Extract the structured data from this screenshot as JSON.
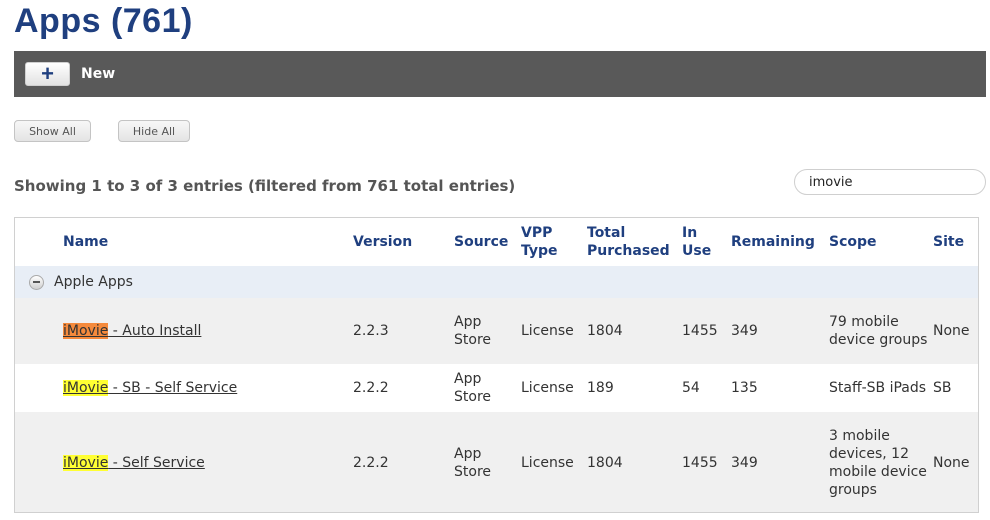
{
  "page": {
    "title": "Apps (761)"
  },
  "toolbar": {
    "new_icon": "+",
    "new_label": "New"
  },
  "buttons": {
    "show_all": "Show All",
    "hide_all": "Hide All"
  },
  "entries_info": "Showing 1 to 3 of 3 entries (filtered from 761 total entries)",
  "search": {
    "value": "imovie"
  },
  "colors": {
    "title": "#1f3f7f",
    "toolbar_bg": "#595959",
    "highlight_current": "#f58a3c",
    "highlight_match": "#ffff33"
  },
  "table": {
    "columns": {
      "name": "Name",
      "version": "Version",
      "source": "Source",
      "vpp_type": "VPP Type",
      "total_purchased": "Total Purchased",
      "in_use": "In Use",
      "remaining": "Remaining",
      "scope": "Scope",
      "site": "Site"
    },
    "group": {
      "label": "Apple Apps",
      "icon": "collapse-icon"
    },
    "rows": [
      {
        "name_match": "iMovie",
        "name_rest": " - Auto Install",
        "version": "2.2.3",
        "source": "App Store",
        "vpp_type": "License",
        "total_purchased": "1804",
        "in_use": "1455",
        "remaining": "349",
        "scope": "79 mobile device groups",
        "site": "None"
      },
      {
        "name_match": "iMovie",
        "name_rest": " - SB - Self Service",
        "version": "2.2.2",
        "source": "App Store",
        "vpp_type": "License",
        "total_purchased": "189",
        "in_use": "54",
        "remaining": "135",
        "scope": "Staff-SB iPads",
        "site": "SB"
      },
      {
        "name_match": "iMovie",
        "name_rest": " - Self Service",
        "version": "2.2.2",
        "source": "App Store",
        "vpp_type": "License",
        "total_purchased": "1804",
        "in_use": "1455",
        "remaining": "349",
        "scope": "3 mobile devices, 12 mobile device groups",
        "site": "None"
      }
    ]
  }
}
